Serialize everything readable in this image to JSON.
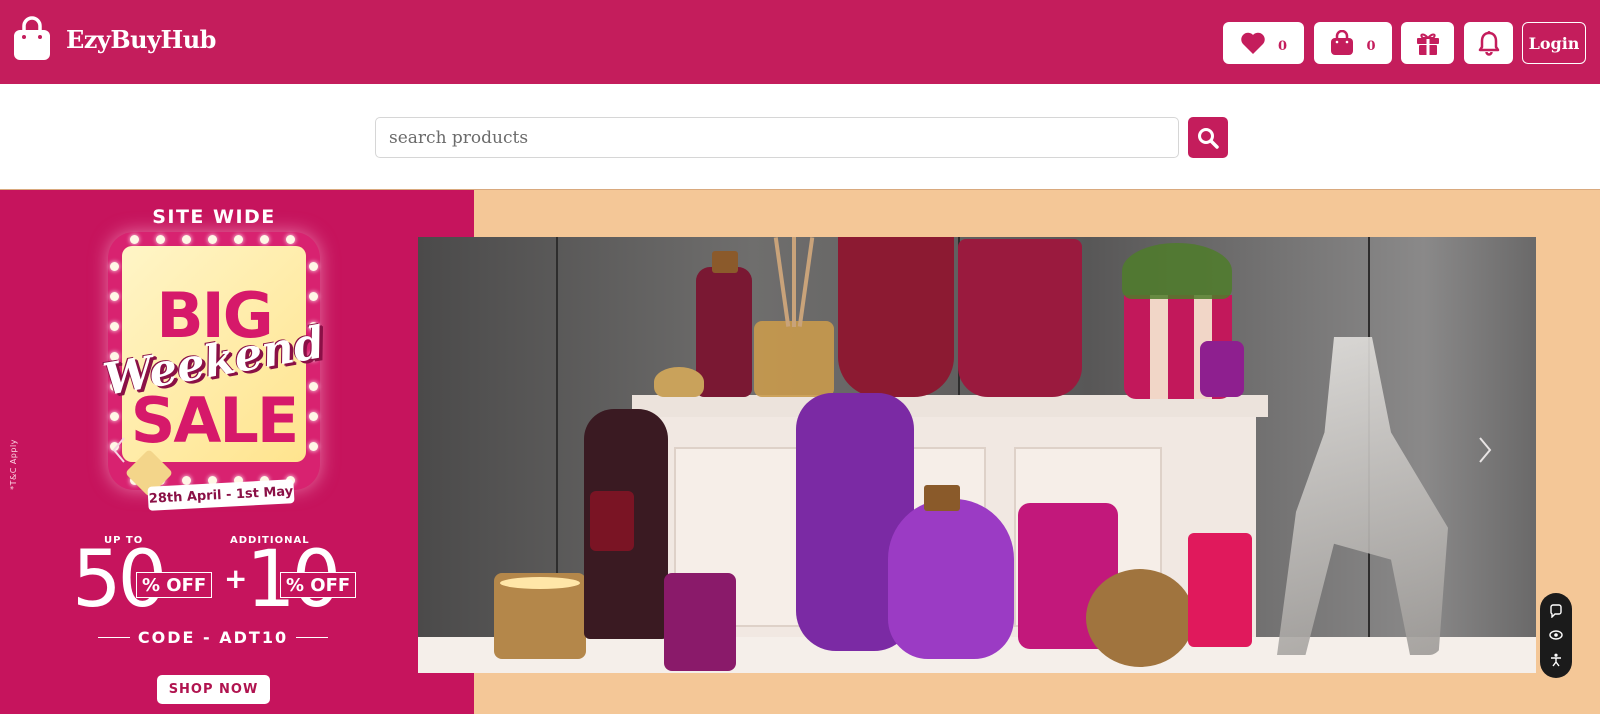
{
  "header": {
    "brand_name": "EzyBuyHub",
    "wishlist_count": "0",
    "cart_count": "0",
    "login_label": "Login",
    "accent_color": "#c41d5c"
  },
  "search": {
    "placeholder": "search products",
    "value": ""
  },
  "banner": {
    "promo": {
      "site_wide": "SITE WIDE",
      "title_line1": "BIG",
      "title_line2": "Weekend",
      "title_line3": "SALE",
      "dates": "28th April - 1st May",
      "up_to": "UP TO",
      "additional": "ADDITIONAL",
      "offer1": "50",
      "offer2": "10",
      "off_label": "% OFF",
      "plus": "+",
      "code": "CODE - ADT10",
      "shop_now": "SHOP NOW",
      "terms": "*T&C Apply",
      "background_color": "#c6145d"
    },
    "background_color": "#f4c797",
    "prev_icon": "chevron-left-icon",
    "next_icon": "chevron-right-icon"
  },
  "widget": {
    "icons": [
      "chat-icon",
      "eye-icon",
      "accessibility-icon"
    ]
  }
}
